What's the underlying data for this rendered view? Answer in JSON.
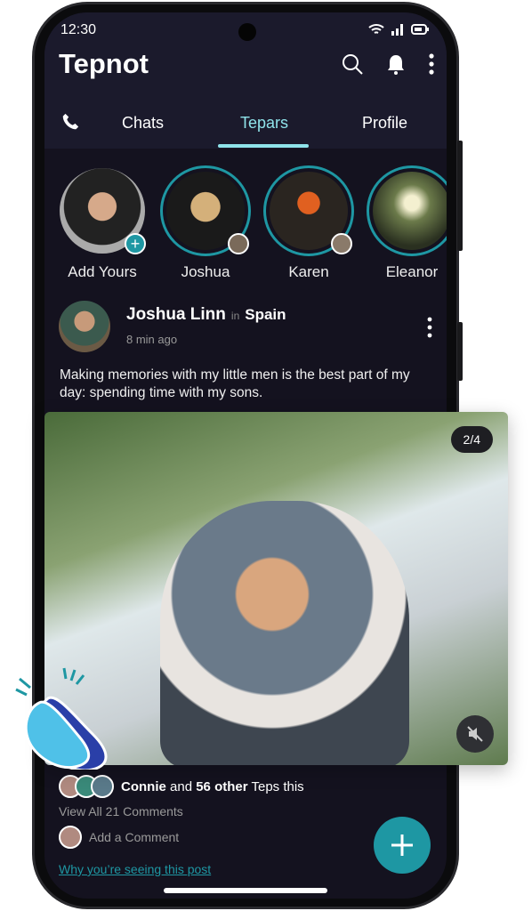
{
  "status_bar": {
    "time": "12:30"
  },
  "header": {
    "title": "Tepnot"
  },
  "tabs": [
    {
      "label": "Chats"
    },
    {
      "label": "Tepars",
      "active": true
    },
    {
      "label": "Profile"
    }
  ],
  "stories": [
    {
      "label": "Add Yours"
    },
    {
      "label": "Joshua"
    },
    {
      "label": "Karen"
    },
    {
      "label": "Eleanor"
    }
  ],
  "post": {
    "author": "Joshua Linn",
    "in": "in",
    "location": "Spain",
    "time": "8 min ago",
    "caption": "Making memories with my little men is the best part of my day: spending time with my sons.",
    "photo_counter": "2/4",
    "likes": {
      "name": "Connie",
      "and": "and",
      "count": "56 other",
      "suffix": "Teps this"
    },
    "view_comments": "View All 21 Comments",
    "add_comment": "Add a Comment",
    "why": "Why you’re seeing this post"
  },
  "colors": {
    "accent": "#1e97a3",
    "tab_active": "#8fe3ea",
    "background": "#14121f",
    "header": "#1b1a2c"
  }
}
